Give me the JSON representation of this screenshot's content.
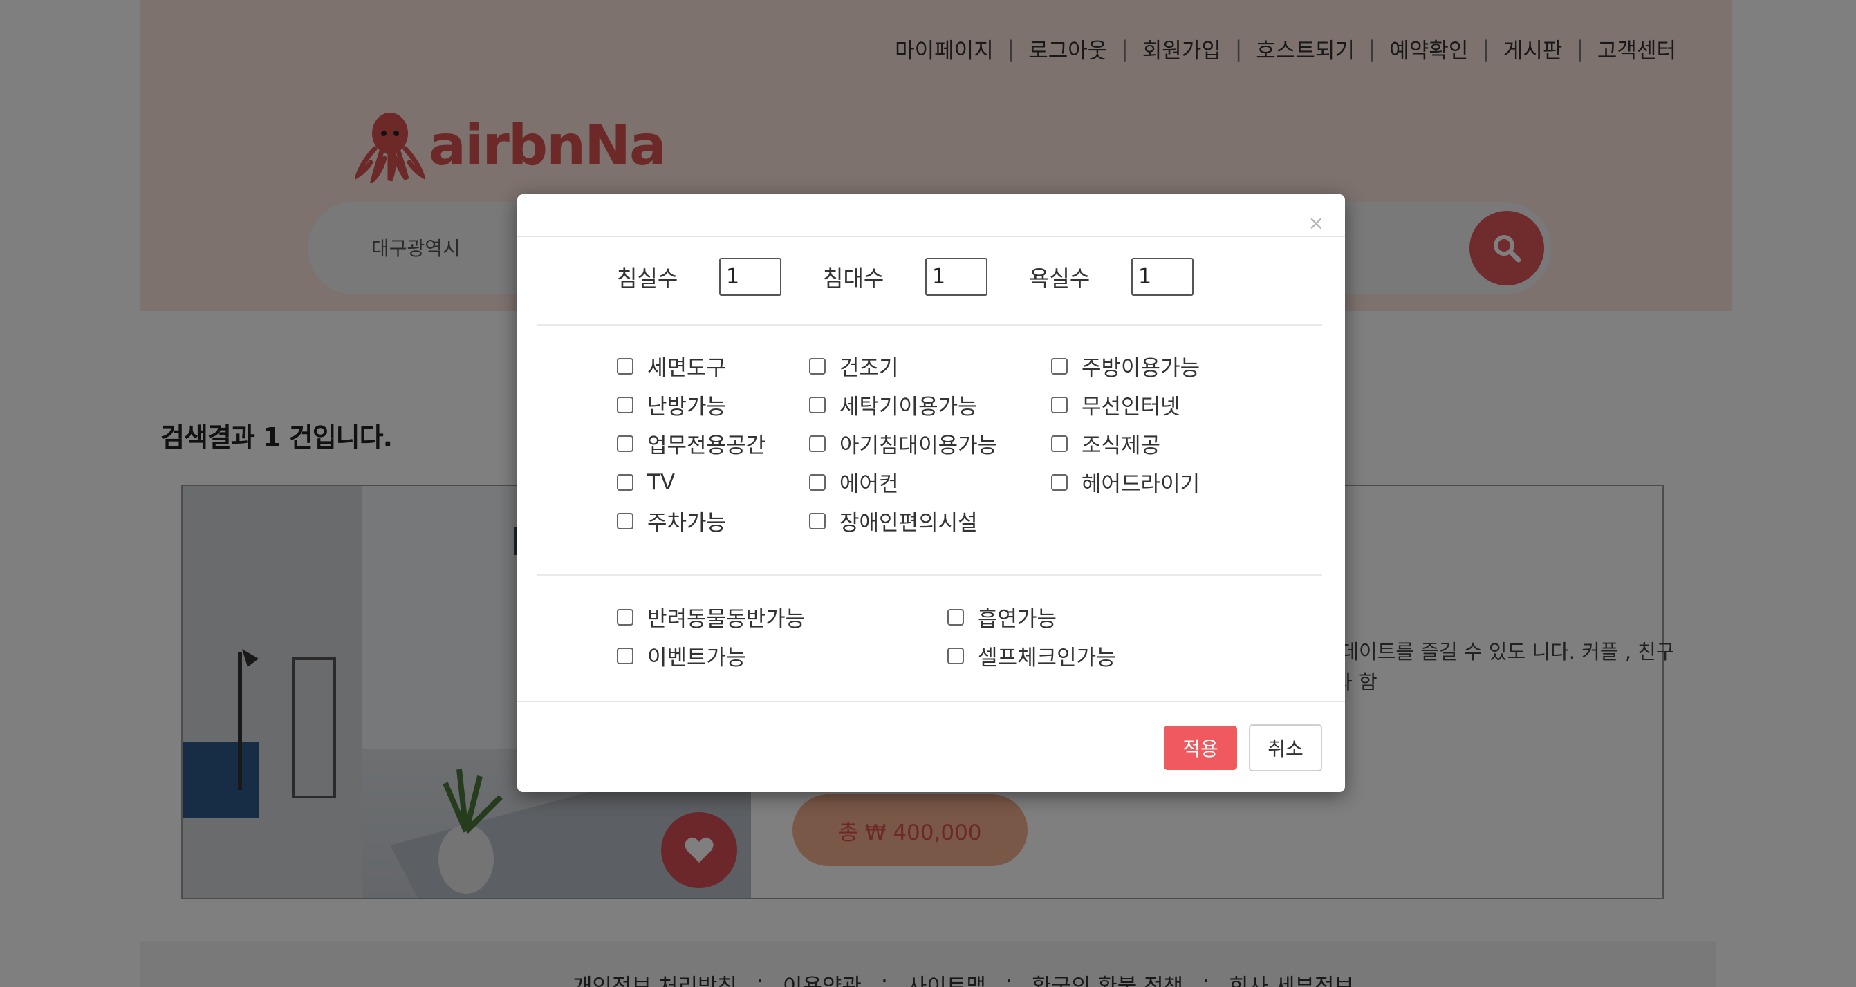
{
  "topnav": {
    "links": [
      "마이페이지",
      "로그아웃",
      "회원가입",
      "호스트되기",
      "예약확인",
      "게시판",
      "고객센터"
    ]
  },
  "logo": {
    "text": "airbnNa",
    "icon": "octopus-icon"
  },
  "search": {
    "location": "대구광역시",
    "icon": "search-icon"
  },
  "results": {
    "title": "검색결과 1 건입니다."
  },
  "card": {
    "description": "에, 편안한 데이트를 즐길 수 있도 니다. 커플 , 친구들, 가족들과 함",
    "price": "총 ₩ 400,000",
    "icon": "heart-icon"
  },
  "footer": {
    "links": [
      "개인정보 처리방침",
      "·",
      "이용약관",
      "·",
      "사이트맵",
      "·",
      "환국의 환불 정책",
      "·",
      "회사 세부정보"
    ]
  },
  "modal": {
    "close_label": "×",
    "counts": [
      {
        "label": "침실수",
        "value": "1"
      },
      {
        "label": "침대수",
        "value": "1"
      },
      {
        "label": "욕실수",
        "value": "1"
      }
    ],
    "amenities": [
      "세면도구",
      "건조기",
      "주방이용가능",
      "난방가능",
      "세탁기이용가능",
      "무선인터넷",
      "업무전용공간",
      "아기침대이용가능",
      "조식제공",
      "TV",
      "에어컨",
      "헤어드라이기",
      "주차가능",
      "장애인편의시설"
    ],
    "extras": [
      "반려동물동반가능",
      "흡연가능",
      "이벤트가능",
      "셀프체크인가능"
    ],
    "apply_label": "적용",
    "cancel_label": "취소"
  },
  "colors": {
    "accent": "#f05a5e",
    "header_bg": "#fbe4dc",
    "logo": "#d9534f"
  }
}
